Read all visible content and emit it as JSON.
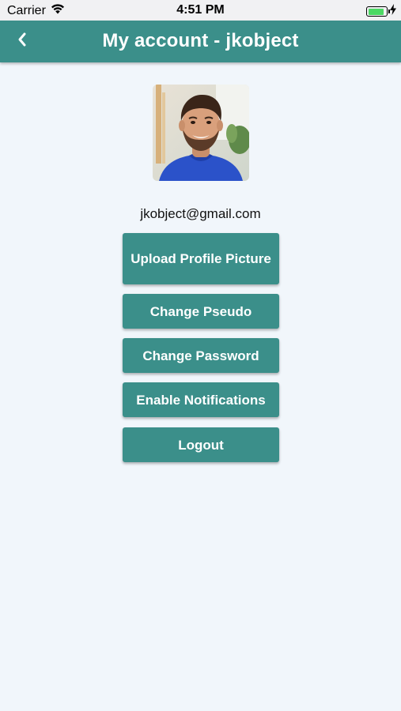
{
  "status_bar": {
    "carrier": "Carrier",
    "time": "4:51 PM",
    "battery_level": 0.9,
    "icons": [
      "wifi-icon",
      "battery-icon",
      "charging-bolt-icon"
    ]
  },
  "header": {
    "title": "My account - jkobject",
    "back_icon": "chevron-left-icon"
  },
  "profile": {
    "email": "jkobject@gmail.com"
  },
  "actions": {
    "upload_profile_picture": "Upload Profile Picture",
    "change_pseudo": "Change Pseudo",
    "change_password": "Change Password",
    "enable_notifications": "Enable Notifications",
    "logout": "Logout"
  },
  "colors": {
    "accent": "#3b8f8a",
    "background": "#f1f6fb",
    "battery": "#4cd964"
  }
}
